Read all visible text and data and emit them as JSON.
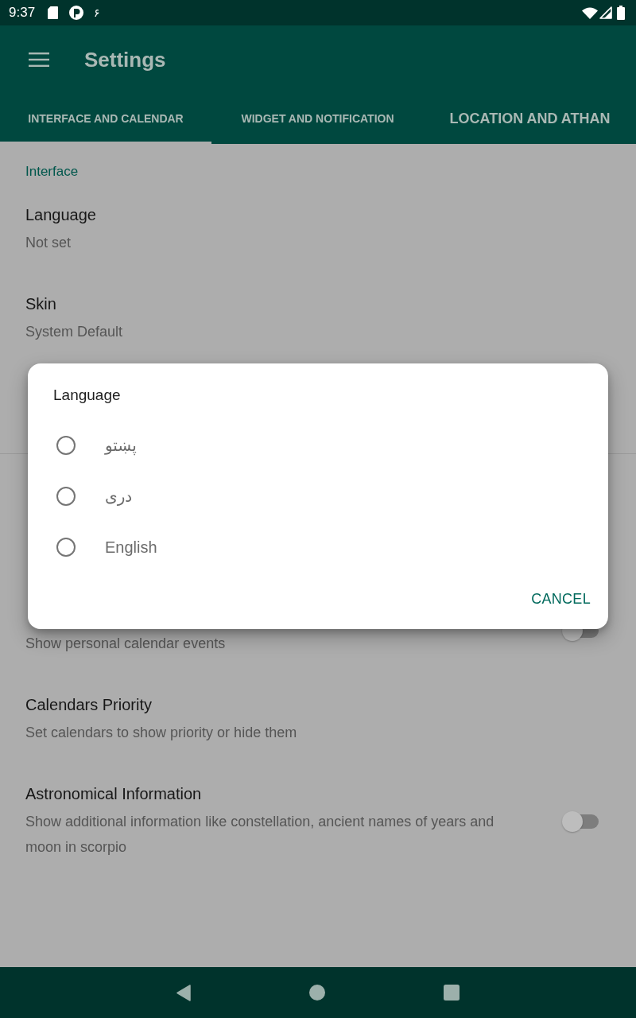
{
  "status_bar": {
    "time": "9:37",
    "notification_glyph": "۶"
  },
  "app_bar": {
    "title": "Settings"
  },
  "tabs": [
    {
      "label": "INTERFACE AND CALENDAR",
      "selected": true
    },
    {
      "label": "WIDGET AND NOTIFICATION",
      "selected": false
    },
    {
      "label": "LOCATION AND ATHAN",
      "selected": false
    }
  ],
  "settings": {
    "groups": [
      {
        "header": "Interface",
        "items": [
          {
            "title": "Language",
            "summary": "Not set"
          },
          {
            "title": "Skin",
            "summary": "System Default"
          }
        ]
      },
      {
        "items": [
          {
            "summary": "Show personal calendar events",
            "switch": {
              "on": false
            }
          },
          {
            "title": "Calendars Priority",
            "summary": "Set calendars to show priority or hide them"
          },
          {
            "title": "Astronomical Information",
            "summary": "Show additional information like constellation, ancient names of years and moon in scorpio",
            "switch": {
              "on": false
            }
          }
        ]
      }
    ]
  },
  "dialog": {
    "title": "Language",
    "options": [
      {
        "label": "پښتو",
        "selected": false
      },
      {
        "label": "دری",
        "selected": false
      },
      {
        "label": "English",
        "selected": false
      }
    ],
    "buttons": [
      {
        "label": "CANCEL"
      }
    ]
  }
}
